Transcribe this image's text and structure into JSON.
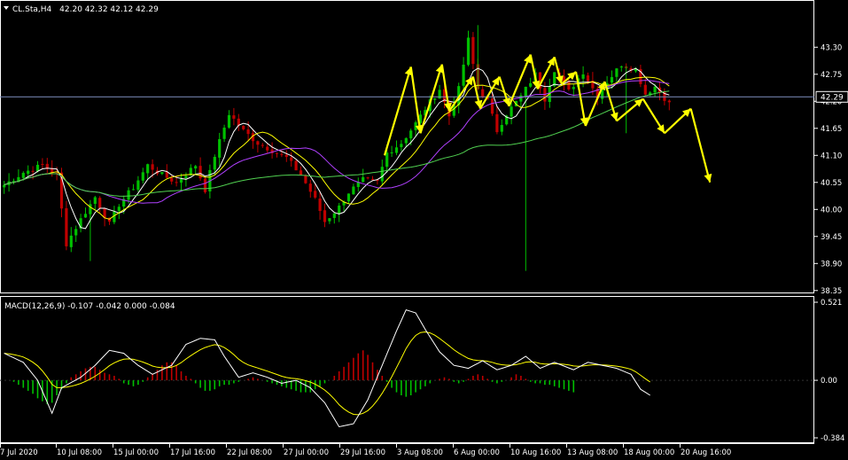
{
  "header": {
    "symbol": "CL.Sta,H4",
    "ohlc": "42.20 42.32 42.12 42.29"
  },
  "macd_header": "MACD(12,26,9) -0.107 -0.042 0.000 -0.084",
  "colors": {
    "background": "#000000",
    "grid": "#ffffff",
    "bull": "#00c000",
    "bear": "#c00000",
    "ma_fast": "#ffffff",
    "ma_mid": "#ffff00",
    "ma_slow": "#b040ff",
    "ma_long": "#50d050",
    "forecast": "#ffff00",
    "price_line": "#7f8fbf",
    "macd_signal": "#ffff00"
  },
  "chart_data": [
    {
      "type": "candlestick",
      "panel": "price",
      "price_axis_ticks": [
        "43.30",
        "42.75",
        "42.20",
        "41.65",
        "41.10",
        "40.55",
        "40.00",
        "39.45",
        "38.90",
        "38.35"
      ],
      "current_price_label": "42.29",
      "current_price": 42.29,
      "ylim": [
        38.31,
        43.9
      ],
      "time_labels": [
        "7 Jul 2020",
        "10 Jul 08:00",
        "15 Jul 00:00",
        "17 Jul 16:00",
        "22 Jul 08:00",
        "27 Jul 00:00",
        "29 Jul 16:00",
        "3 Aug 08:00",
        "6 Aug 00:00",
        "10 Aug 16:00",
        "13 Aug 08:00",
        "18 Aug 00:00",
        "20 Aug 16:00"
      ],
      "close_path": [
        [
          0,
          40.5
        ],
        [
          4,
          40.75
        ],
        [
          8,
          40.9
        ],
        [
          11,
          40.7
        ],
        [
          13,
          39.3
        ],
        [
          16,
          39.8
        ],
        [
          19,
          40.25
        ],
        [
          22,
          39.7
        ],
        [
          24,
          40.1
        ],
        [
          27,
          40.45
        ],
        [
          30,
          40.9
        ],
        [
          33,
          40.7
        ],
        [
          36,
          40.55
        ],
        [
          40,
          40.9
        ],
        [
          42,
          40.4
        ],
        [
          44,
          41.1
        ],
        [
          47,
          41.95
        ],
        [
          50,
          41.6
        ],
        [
          53,
          41.35
        ],
        [
          56,
          41.2
        ],
        [
          59,
          41.05
        ],
        [
          62,
          40.7
        ],
        [
          65,
          40.2
        ],
        [
          67,
          39.75
        ],
        [
          70,
          40.05
        ],
        [
          72,
          40.35
        ],
        [
          75,
          40.6
        ],
        [
          78,
          40.55
        ],
        [
          80,
          41.15
        ],
        [
          83,
          41.35
        ],
        [
          86,
          41.75
        ],
        [
          88,
          42.05
        ],
        [
          91,
          42.45
        ],
        [
          93,
          41.9
        ],
        [
          95,
          42.45
        ],
        [
          97,
          43.45
        ],
        [
          99,
          42.45
        ],
        [
          101,
          42.2
        ],
        [
          103,
          41.6
        ],
        [
          105,
          41.95
        ],
        [
          108,
          42.3
        ],
        [
          111,
          42.75
        ],
        [
          113,
          42.25
        ],
        [
          115,
          42.85
        ],
        [
          118,
          42.4
        ],
        [
          121,
          42.8
        ],
        [
          124,
          42.3
        ],
        [
          126,
          42.6
        ],
        [
          129,
          42.95
        ],
        [
          132,
          42.85
        ],
        [
          134,
          42.35
        ],
        [
          136,
          42.5
        ],
        [
          139,
          42.15
        ]
      ],
      "moving_averages": [
        "ma_fast",
        "ma_mid",
        "ma_slow",
        "ma_long"
      ],
      "forecast_path": [
        [
          80,
          41.1
        ],
        [
          85.5,
          42.9
        ],
        [
          87.5,
          41.55
        ],
        [
          92,
          42.95
        ],
        [
          93.5,
          42.0
        ],
        [
          98.5,
          42.7
        ],
        [
          100,
          42.05
        ],
        [
          104,
          42.7
        ],
        [
          106,
          42.1
        ],
        [
          110.5,
          43.15
        ],
        [
          112,
          42.45
        ],
        [
          115.5,
          43.1
        ],
        [
          117,
          42.55
        ],
        [
          120,
          42.8
        ],
        [
          122,
          41.7
        ],
        [
          126,
          42.6
        ],
        [
          128.5,
          41.8
        ],
        [
          134,
          42.25
        ],
        [
          138.5,
          41.55
        ],
        [
          144,
          42.05
        ],
        [
          148,
          40.55
        ]
      ]
    },
    {
      "type": "macd",
      "panel": "macd",
      "axis_ticks": [
        "0.521",
        "0.00",
        "-0.384"
      ],
      "ylim": [
        -0.384,
        0.521
      ],
      "macd_path": [
        [
          0,
          0.18
        ],
        [
          4,
          0.12
        ],
        [
          7,
          0.0
        ],
        [
          10,
          -0.22
        ],
        [
          12,
          -0.05
        ],
        [
          16,
          0.02
        ],
        [
          19,
          0.1
        ],
        [
          22,
          0.2
        ],
        [
          25,
          0.18
        ],
        [
          28,
          0.1
        ],
        [
          31,
          0.04
        ],
        [
          35,
          0.1
        ],
        [
          38,
          0.24
        ],
        [
          41,
          0.28
        ],
        [
          44,
          0.27
        ],
        [
          46,
          0.16
        ],
        [
          49,
          0.02
        ],
        [
          52,
          0.05
        ],
        [
          55,
          0.02
        ],
        [
          58,
          -0.02
        ],
        [
          61,
          0.0
        ],
        [
          64,
          -0.05
        ],
        [
          67,
          -0.15
        ],
        [
          70,
          -0.31
        ],
        [
          73,
          -0.29
        ],
        [
          76,
          -0.13
        ],
        [
          79,
          0.1
        ],
        [
          82,
          0.33
        ],
        [
          84,
          0.47
        ],
        [
          86,
          0.45
        ],
        [
          88,
          0.34
        ],
        [
          91,
          0.19
        ],
        [
          94,
          0.1
        ],
        [
          97,
          0.08
        ],
        [
          100,
          0.13
        ],
        [
          103,
          0.07
        ],
        [
          106,
          0.1
        ],
        [
          109,
          0.16
        ],
        [
          112,
          0.08
        ],
        [
          115,
          0.12
        ],
        [
          119,
          0.07
        ],
        [
          122,
          0.12
        ],
        [
          125,
          0.1
        ],
        [
          128,
          0.08
        ],
        [
          131,
          0.04
        ],
        [
          133,
          -0.06
        ],
        [
          135,
          -0.1
        ]
      ],
      "histogram": [
        0.0,
        0.0,
        -0.01,
        -0.03,
        -0.05,
        -0.07,
        -0.09,
        -0.12,
        -0.14,
        -0.16,
        -0.15,
        -0.1,
        -0.06,
        -0.02,
        0.02,
        0.04,
        0.06,
        0.08,
        0.09,
        0.09,
        0.07,
        0.05,
        0.04,
        0.03,
        0.01,
        -0.02,
        -0.03,
        -0.04,
        -0.03,
        -0.01,
        0.02,
        0.04,
        0.07,
        0.1,
        0.12,
        0.12,
        0.1,
        0.06,
        0.03,
        0.01,
        -0.02,
        -0.05,
        -0.07,
        -0.07,
        -0.06,
        -0.04,
        -0.03,
        -0.03,
        -0.02,
        -0.01,
        0.0,
        0.01,
        0.02,
        0.01,
        0.0,
        -0.01,
        -0.02,
        -0.03,
        -0.04,
        -0.05,
        -0.06,
        -0.07,
        -0.08,
        -0.08,
        -0.08,
        -0.06,
        -0.04,
        -0.02,
        0.0,
        0.03,
        0.06,
        0.09,
        0.12,
        0.15,
        0.18,
        0.2,
        0.17,
        0.12,
        0.07,
        0.03,
        -0.01,
        -0.05,
        -0.08,
        -0.1,
        -0.11,
        -0.1,
        -0.08,
        -0.06,
        -0.04,
        -0.02,
        0.0,
        0.01,
        0.02,
        0.01,
        -0.01,
        -0.02,
        -0.01,
        0.01,
        0.03,
        0.04,
        0.03,
        0.01,
        -0.01,
        -0.02,
        -0.01,
        0.0,
        0.02,
        0.04,
        0.03,
        0.01,
        -0.01,
        -0.02,
        -0.02,
        -0.03,
        -0.03,
        -0.04,
        -0.05,
        -0.06,
        -0.07,
        -0.08
      ]
    }
  ]
}
